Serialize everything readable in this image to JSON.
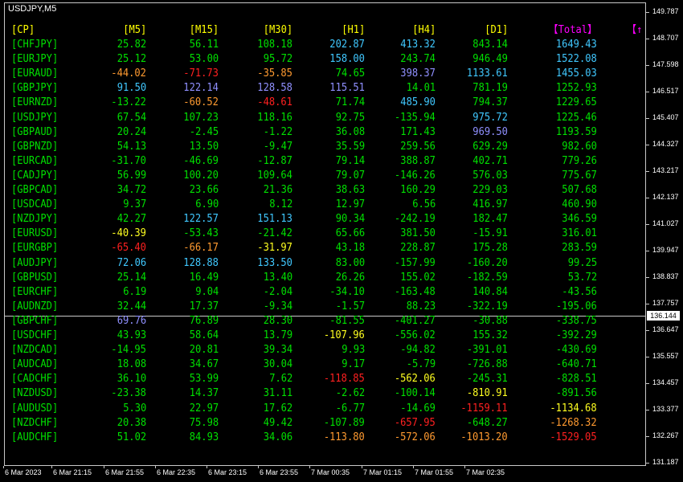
{
  "window": {
    "title": "USDJPY,M5"
  },
  "table": {
    "headers": [
      {
        "label": "[CP]",
        "color": "#ffff00"
      },
      {
        "label": "[M5]",
        "color": "#ffff00"
      },
      {
        "label": "[M15]",
        "color": "#ffff00"
      },
      {
        "label": "[M30]",
        "color": "#ffff00"
      },
      {
        "label": "[H1]",
        "color": "#ffff00"
      },
      {
        "label": "[H4]",
        "color": "#ffff00"
      },
      {
        "label": "[D1]",
        "color": "#ffff00"
      },
      {
        "label": "【Total】",
        "color": "#ff00ff"
      },
      {
        "label": "【↑",
        "color": "#ff00ff"
      }
    ],
    "rows": [
      {
        "sym": "[CHFJPY]",
        "v": [
          "25.82",
          "56.11",
          "108.18",
          "202.87",
          "413.32",
          "843.14",
          "1649.43"
        ],
        "c": [
          "g",
          "g",
          "g",
          "c",
          "c",
          "g",
          "c"
        ]
      },
      {
        "sym": "[EURJPY]",
        "v": [
          "25.12",
          "53.00",
          "95.72",
          "158.00",
          "243.74",
          "946.49",
          "1522.08"
        ],
        "c": [
          "g",
          "g",
          "g",
          "c",
          "g",
          "g",
          "c"
        ]
      },
      {
        "sym": "[EURAUD]",
        "v": [
          "-44.02",
          "-71.73",
          "-35.85",
          "74.65",
          "398.37",
          "1133.61",
          "1455.03"
        ],
        "c": [
          "o",
          "r",
          "o",
          "g",
          "p",
          "c",
          "c"
        ]
      },
      {
        "sym": "[GBPJPY]",
        "v": [
          "91.50",
          "122.14",
          "128.58",
          "115.51",
          "14.01",
          "781.19",
          "1252.93"
        ],
        "c": [
          "c",
          "p",
          "p",
          "p",
          "g",
          "g",
          "g"
        ]
      },
      {
        "sym": "[EURNZD]",
        "v": [
          "-13.22",
          "-60.52",
          "-48.61",
          "71.74",
          "485.90",
          "794.37",
          "1229.65"
        ],
        "c": [
          "g",
          "o",
          "r",
          "g",
          "c",
          "g",
          "g"
        ]
      },
      {
        "sym": "[USDJPY]",
        "v": [
          "67.54",
          "107.23",
          "118.16",
          "92.75",
          "-135.94",
          "975.72",
          "1225.46"
        ],
        "c": [
          "g",
          "g",
          "g",
          "g",
          "g",
          "c",
          "g"
        ]
      },
      {
        "sym": "[GBPAUD]",
        "v": [
          "20.24",
          "-2.45",
          "-1.22",
          "36.08",
          "171.43",
          "969.50",
          "1193.59"
        ],
        "c": [
          "g",
          "g",
          "g",
          "g",
          "g",
          "p",
          "g"
        ]
      },
      {
        "sym": "[GBPNZD]",
        "v": [
          "54.13",
          "13.50",
          "-9.47",
          "35.59",
          "259.56",
          "629.29",
          "982.60"
        ],
        "c": [
          "g",
          "g",
          "g",
          "g",
          "g",
          "g",
          "g"
        ]
      },
      {
        "sym": "[EURCAD]",
        "v": [
          "-31.70",
          "-46.69",
          "-12.87",
          "79.14",
          "388.87",
          "402.71",
          "779.26"
        ],
        "c": [
          "g",
          "g",
          "g",
          "g",
          "g",
          "g",
          "g"
        ]
      },
      {
        "sym": "[CADJPY]",
        "v": [
          "56.99",
          "100.20",
          "109.64",
          "79.07",
          "-146.26",
          "576.03",
          "775.67"
        ],
        "c": [
          "g",
          "g",
          "g",
          "g",
          "g",
          "g",
          "g"
        ]
      },
      {
        "sym": "[GBPCAD]",
        "v": [
          "34.72",
          "23.66",
          "21.36",
          "38.63",
          "160.29",
          "229.03",
          "507.68"
        ],
        "c": [
          "g",
          "g",
          "g",
          "g",
          "g",
          "g",
          "g"
        ]
      },
      {
        "sym": "[USDCAD]",
        "v": [
          "9.37",
          "6.90",
          "8.12",
          "12.97",
          "6.56",
          "416.97",
          "460.90"
        ],
        "c": [
          "g",
          "g",
          "g",
          "g",
          "g",
          "g",
          "g"
        ]
      },
      {
        "sym": "[NZDJPY]",
        "v": [
          "42.27",
          "122.57",
          "151.13",
          "90.34",
          "-242.19",
          "182.47",
          "346.59"
        ],
        "c": [
          "g",
          "c",
          "c",
          "g",
          "g",
          "g",
          "g"
        ]
      },
      {
        "sym": "[EURUSD]",
        "v": [
          "-40.39",
          "-53.43",
          "-21.42",
          "65.66",
          "381.50",
          "-15.91",
          "316.01"
        ],
        "c": [
          "y",
          "g",
          "g",
          "g",
          "g",
          "g",
          "g"
        ]
      },
      {
        "sym": "[EURGBP]",
        "v": [
          "-65.40",
          "-66.17",
          "-31.97",
          "43.18",
          "228.87",
          "175.28",
          "283.59"
        ],
        "c": [
          "r",
          "o",
          "y",
          "g",
          "g",
          "g",
          "g"
        ]
      },
      {
        "sym": "[AUDJPY]",
        "v": [
          "72.06",
          "128.88",
          "133.50",
          "83.00",
          "-157.99",
          "-160.20",
          "99.25"
        ],
        "c": [
          "c",
          "c",
          "c",
          "g",
          "g",
          "g",
          "g"
        ]
      },
      {
        "sym": "[GBPUSD]",
        "v": [
          "25.14",
          "16.49",
          "13.40",
          "26.26",
          "155.02",
          "-182.59",
          "53.72"
        ],
        "c": [
          "g",
          "g",
          "g",
          "g",
          "g",
          "g",
          "g"
        ]
      },
      {
        "sym": "[EURCHF]",
        "v": [
          "6.19",
          "9.04",
          "-2.04",
          "-34.10",
          "-163.48",
          "140.84",
          "-43.56"
        ],
        "c": [
          "g",
          "g",
          "g",
          "g",
          "g",
          "g",
          "g"
        ]
      },
      {
        "sym": "[AUDNZD]",
        "v": [
          "32.44",
          "17.37",
          "-9.34",
          "-1.57",
          "88.23",
          "-322.19",
          "-195.06"
        ],
        "c": [
          "g",
          "g",
          "g",
          "g",
          "g",
          "g",
          "g"
        ]
      },
      {
        "sym": "[GBPCHF]",
        "v": [
          "69.76",
          "76.89",
          "28.30",
          "-81.55",
          "-401.27",
          "-30.88",
          "-338.75"
        ],
        "c": [
          "p",
          "g",
          "g",
          "g",
          "g",
          "g",
          "g"
        ]
      },
      {
        "sym": "[USDCHF]",
        "v": [
          "43.93",
          "58.64",
          "13.79",
          "-107.96",
          "-556.02",
          "155.32",
          "-392.29"
        ],
        "c": [
          "g",
          "g",
          "g",
          "y",
          "g",
          "g",
          "g"
        ]
      },
      {
        "sym": "[NZDCAD]",
        "v": [
          "-14.95",
          "20.81",
          "39.34",
          "9.93",
          "-94.82",
          "-391.01",
          "-430.69"
        ],
        "c": [
          "g",
          "g",
          "g",
          "g",
          "g",
          "g",
          "g"
        ]
      },
      {
        "sym": "[AUDCAD]",
        "v": [
          "18.08",
          "34.67",
          "30.04",
          "9.17",
          "-5.79",
          "-726.88",
          "-640.71"
        ],
        "c": [
          "g",
          "g",
          "g",
          "g",
          "g",
          "g",
          "g"
        ]
      },
      {
        "sym": "[CADCHF]",
        "v": [
          "36.10",
          "53.99",
          "7.62",
          "-118.85",
          "-562.06",
          "-245.31",
          "-828.51"
        ],
        "c": [
          "g",
          "g",
          "g",
          "r",
          "y",
          "g",
          "g"
        ]
      },
      {
        "sym": "[NZDUSD]",
        "v": [
          "-23.38",
          "14.37",
          "31.11",
          "-2.62",
          "-100.14",
          "-810.91",
          "-891.56"
        ],
        "c": [
          "g",
          "g",
          "g",
          "g",
          "g",
          "y",
          "g"
        ]
      },
      {
        "sym": "[AUDUSD]",
        "v": [
          "5.30",
          "22.97",
          "17.62",
          "-6.77",
          "-14.69",
          "-1159.11",
          "-1134.68"
        ],
        "c": [
          "g",
          "g",
          "g",
          "g",
          "g",
          "r",
          "y"
        ]
      },
      {
        "sym": "[NZDCHF]",
        "v": [
          "20.38",
          "75.98",
          "49.42",
          "-107.89",
          "-657.95",
          "-648.27",
          "-1268.32"
        ],
        "c": [
          "g",
          "g",
          "g",
          "g",
          "r",
          "g",
          "o"
        ]
      },
      {
        "sym": "[AUDCHF]",
        "v": [
          "51.02",
          "84.93",
          "34.06",
          "-113.80",
          "-572.06",
          "-1013.20",
          "-1529.05"
        ],
        "c": [
          "g",
          "g",
          "g",
          "o",
          "o",
          "o",
          "r"
        ]
      }
    ]
  },
  "palette": {
    "g": "#00e000",
    "c": "#40c8ff",
    "p": "#9090ff",
    "o": "#ff9a30",
    "r": "#ff2020",
    "y": "#ffff20",
    "sym": "#00e000"
  },
  "price_axis": {
    "labels": [
      "149.787",
      "148.707",
      "147.598",
      "146.517",
      "145.407",
      "144.327",
      "143.217",
      "142.137",
      "141.027",
      "139.947",
      "138.837",
      "137.757",
      "136.647",
      "135.557",
      "134.457",
      "133.377",
      "132.267",
      "131.187"
    ],
    "current_price": "136.144"
  },
  "time_axis": {
    "labels": [
      "6 Mar 2023",
      "6 Mar 21:15",
      "6 Mar 21:55",
      "6 Mar 22:35",
      "6 Mar 23:15",
      "6 Mar 23:55",
      "7 Mar 00:35",
      "7 Mar 01:15",
      "7 Mar 01:55",
      "7 Mar 02:35"
    ]
  }
}
